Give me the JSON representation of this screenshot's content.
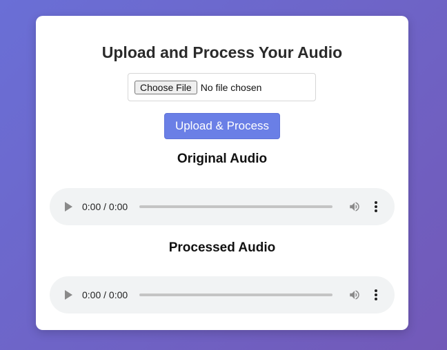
{
  "page": {
    "title": "Upload and Process Your Audio"
  },
  "file_input": {
    "button_label": "Choose File",
    "status": "No file chosen"
  },
  "upload_button": {
    "label": "Upload & Process"
  },
  "original": {
    "heading": "Original Audio",
    "time": "0:00 / 0:00"
  },
  "processed": {
    "heading": "Processed Audio",
    "time": "0:00 / 0:00"
  },
  "icons": {
    "play": "play-icon",
    "volume": "volume-icon",
    "more": "more-vertical-icon"
  },
  "colors": {
    "background_start": "#6a6fd6",
    "background_end": "#7259b8",
    "button": "#6a7fe6",
    "player_bg": "#f1f3f4"
  }
}
